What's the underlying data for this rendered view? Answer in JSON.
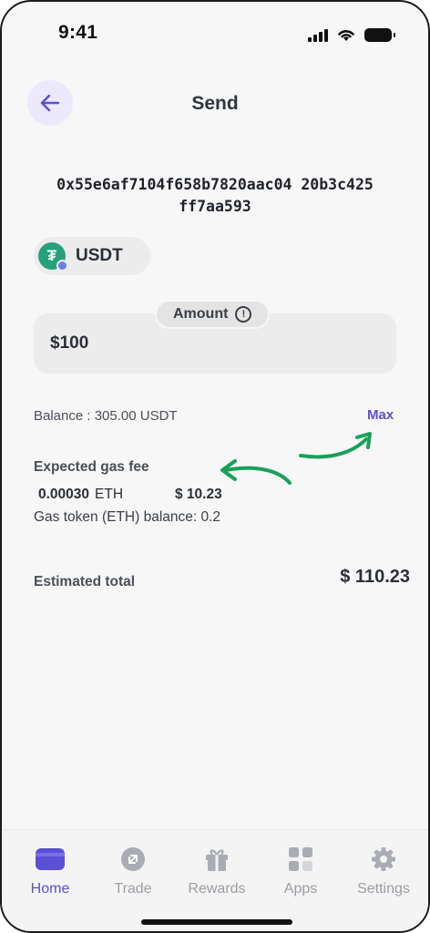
{
  "status_bar": {
    "time": "9:41"
  },
  "header": {
    "title": "Send"
  },
  "recipient": {
    "address": "0x55e6af7104f658b7820aac04 20b3c425ff7aa593"
  },
  "token": {
    "symbol": "USDT",
    "logo_glyph": "₮",
    "color": "#26a17b"
  },
  "amount": {
    "label": "Amount",
    "value": "$100"
  },
  "balance": {
    "text": "Balance : 305.00 USDT",
    "max_label": "Max"
  },
  "gas": {
    "heading": "Expected gas fee",
    "eth_amount": "0.00030",
    "eth_unit": "ETH",
    "usd_amount": "$ 10.23",
    "token_balance": "Gas token (ETH) balance: 0.2"
  },
  "total": {
    "label": "Estimated total",
    "value": "$ 110.23"
  },
  "nav": {
    "items": [
      {
        "label": "Home",
        "icon": "wallet-icon",
        "active": true
      },
      {
        "label": "Trade",
        "icon": "trade-icon",
        "active": false
      },
      {
        "label": "Rewards",
        "icon": "gift-icon",
        "active": false
      },
      {
        "label": "Apps",
        "icon": "apps-icon",
        "active": false
      },
      {
        "label": "Settings",
        "icon": "gear-icon",
        "active": false
      }
    ]
  },
  "colors": {
    "accent": "#5b4fd6",
    "annotation_arrow": "#1aa05a"
  }
}
